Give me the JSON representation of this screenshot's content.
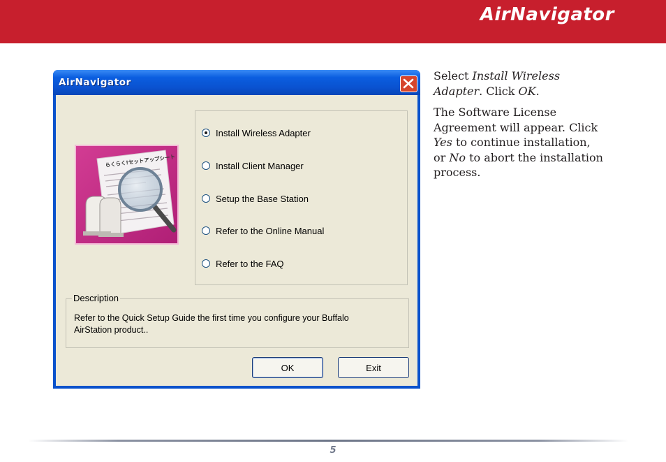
{
  "header": {
    "title": "AirNavigator",
    "color": "#c71f2d"
  },
  "dialog": {
    "title": "AirNavigator",
    "options": [
      {
        "label": "Install Wireless Adapter",
        "selected": true
      },
      {
        "label": "Install Client Manager",
        "selected": false
      },
      {
        "label": "Setup the Base Station",
        "selected": false
      },
      {
        "label": "Refer to the Online Manual",
        "selected": false
      },
      {
        "label": "Refer to the FAQ",
        "selected": false
      }
    ],
    "description": {
      "legend": "Description",
      "line1": "Refer to the Quick Setup Guide the first time you configure your Buffalo",
      "line2": "AirStation product.."
    },
    "buttons": {
      "ok": "OK",
      "exit": "Exit"
    },
    "product_image_caption": "らくらく!セットアップシート"
  },
  "instructions": {
    "p1": {
      "t1": "Select ",
      "e1": "Install Wireless Adapter",
      "t2": ".  Click ",
      "e2": "OK",
      "t3": "."
    },
    "p2": {
      "t1": "The Software License Agreement will appear.  Click ",
      "e1": "Yes",
      "t2": " to continue installation, or ",
      "e2": "No",
      "t3": " to abort the installation process."
    }
  },
  "footer": {
    "page_number": "5"
  }
}
